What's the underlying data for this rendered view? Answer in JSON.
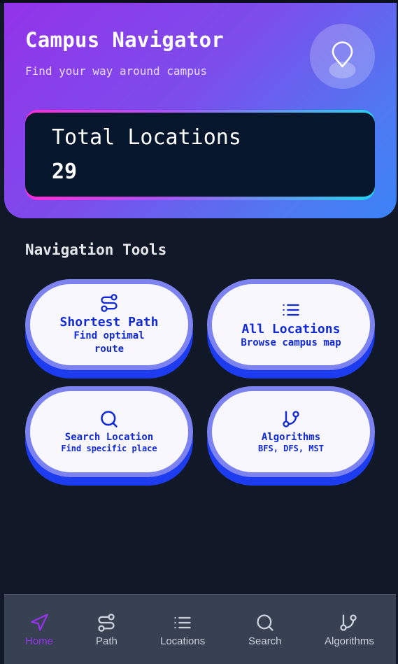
{
  "header": {
    "title": "Campus Navigator",
    "subtitle": "Find your way around campus",
    "icon": "map-pin-icon"
  },
  "stats": {
    "label": "Total Locations",
    "value": "29"
  },
  "tools": {
    "section_title": "Navigation Tools",
    "items": [
      {
        "title": "Shortest Path",
        "subtitle": "Find optimal route",
        "icon": "route-icon"
      },
      {
        "title": "All Locations",
        "subtitle": "Browse campus map",
        "icon": "list-icon"
      },
      {
        "title": "Search Location",
        "subtitle": "Find specific place",
        "icon": "search-icon"
      },
      {
        "title": "Algorithms",
        "subtitle": "BFS, DFS, MST",
        "icon": "git-branch-icon"
      }
    ]
  },
  "nav": {
    "items": [
      {
        "label": "Home",
        "icon": "navigation-arrow-icon",
        "active": true
      },
      {
        "label": "Path",
        "icon": "route-icon",
        "active": false
      },
      {
        "label": "Locations",
        "icon": "list-icon",
        "active": false
      },
      {
        "label": "Search",
        "icon": "search-icon",
        "active": false
      },
      {
        "label": "Algorithms",
        "icon": "git-branch-icon",
        "active": false
      }
    ]
  },
  "colors": {
    "accent": "#9333ea",
    "tile_text": "#1129d6",
    "background": "#111827",
    "nav_bg": "#374151"
  }
}
